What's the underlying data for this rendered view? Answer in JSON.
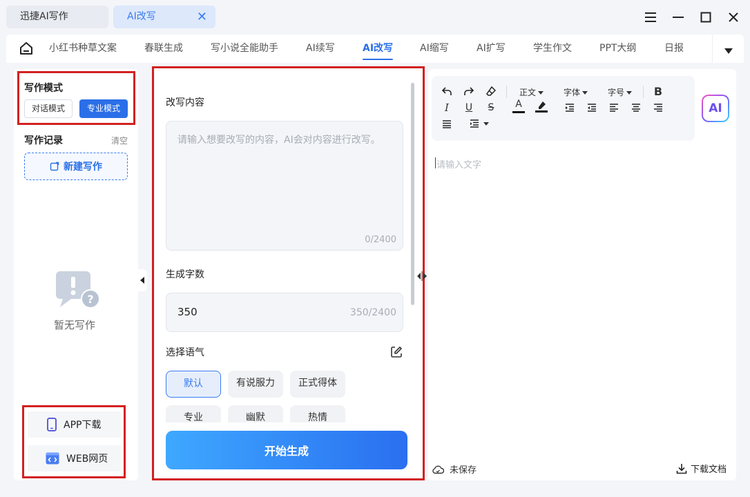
{
  "window": {
    "tabs": [
      "迅捷AI写作",
      "AI改写"
    ],
    "tab_close": "✕"
  },
  "nav": {
    "items": [
      "小红书种草文案",
      "春联生成",
      "写小说全能助手",
      "AI续写",
      "AI改写",
      "AI缩写",
      "AI扩写",
      "学生作文",
      "PPT大纲",
      "日报"
    ],
    "active_index": 4
  },
  "sidebar": {
    "mode_title": "写作模式",
    "mode_chat": "对话模式",
    "mode_pro": "专业模式",
    "selected_mode": "专业模式",
    "record_title": "写作记录",
    "clear": "清空",
    "new_writing": "新建写作",
    "empty_text": "暂无写作",
    "app_download": "APP下载",
    "web_page": "WEB网页"
  },
  "form": {
    "content_label": "改写内容",
    "content_placeholder": "请输入想要改写的内容，AI会对内容进行改写。",
    "content_count": "0/2400",
    "words_label": "生成字数",
    "words_value": "350",
    "words_count": "350/2400",
    "tone_label": "选择语气",
    "tones": [
      "默认",
      "有说服力",
      "正式得体",
      "专业",
      "幽默",
      "热情"
    ],
    "selected_tone": "默认",
    "generate_button": "开始生成"
  },
  "editor": {
    "toolbar": {
      "paragraph": "正文",
      "font": "字体",
      "size": "字号",
      "bold": "B",
      "italic": "I",
      "underline": "U",
      "strike": "S",
      "font_color": "A"
    },
    "ai_badge": "AI",
    "placeholder": "请输入文字",
    "status": "未保存",
    "download": "下载文档"
  },
  "colors": {
    "accent": "#2b6fe8",
    "highlight_box": "#d32020",
    "generate_gradient_start": "#3ea8ff",
    "generate_gradient_end": "#2a6ff0"
  }
}
